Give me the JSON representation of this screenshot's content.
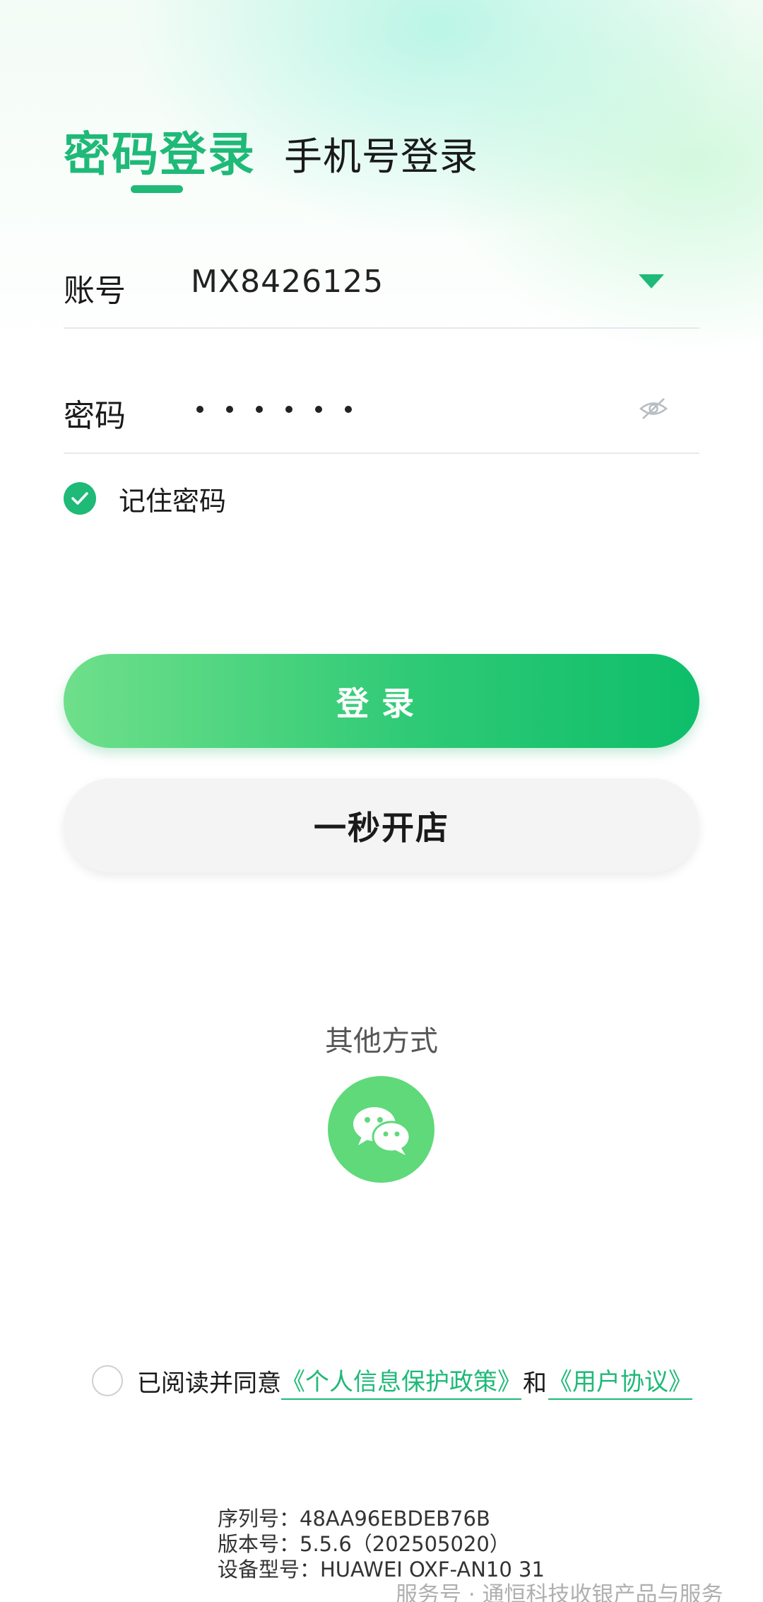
{
  "tabs": {
    "active": "密码登录",
    "other": "手机号登录"
  },
  "account": {
    "label": "账号",
    "value": "MX8426125"
  },
  "password": {
    "label": "密码",
    "masked_length": 6
  },
  "remember": {
    "label": "记住密码",
    "checked": true
  },
  "buttons": {
    "login": "登录",
    "open_store": "一秒开店"
  },
  "other_methods": {
    "label": "其他方式",
    "icon": "wechat-icon"
  },
  "agreement": {
    "prefix": "已阅读并同意",
    "privacy_link": "《个人信息保护政策》",
    "and": "和",
    "user_link": "《用户协议》",
    "checked": false
  },
  "device": {
    "serial": "序列号：48AA96EBDEB76B",
    "version": "版本号：5.5.6（202505020）",
    "model": "设备型号：HUAWEI OXF-AN10 31"
  },
  "watermark": "服务号 · 通恒科技收银产品与服务",
  "colors": {
    "accent": "#1fb978",
    "wechat": "#5fd97a",
    "login_gradient_start": "#6fdf8a",
    "login_gradient_end": "#0ebe6a"
  }
}
